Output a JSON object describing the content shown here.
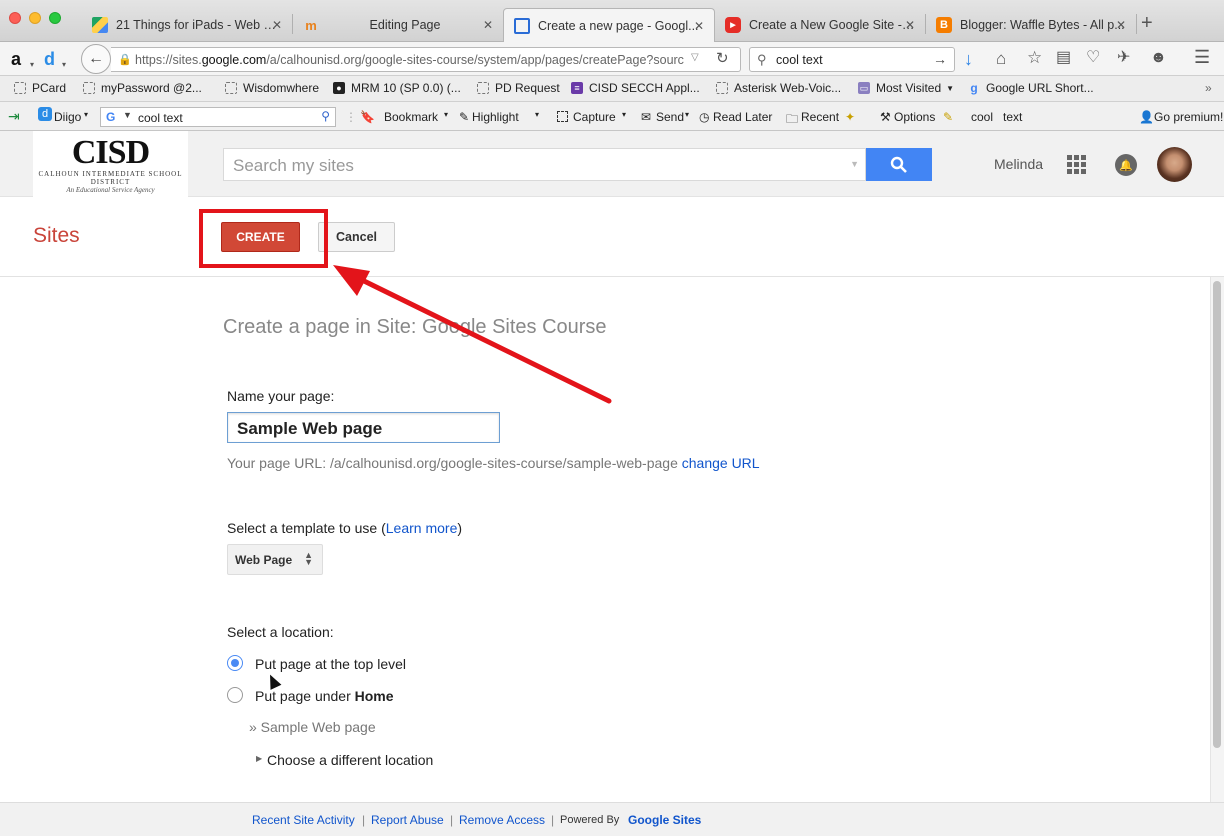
{
  "tabs": [
    {
      "label": "21 Things for iPads - Web R...",
      "icon": "google-drive-icon",
      "active": false
    },
    {
      "label": "Editing Page",
      "icon": "moodle-icon",
      "active": false
    },
    {
      "label": "Create a new page - Googl...",
      "icon": "google-sites-icon",
      "active": true
    },
    {
      "label": "Create a New Google Site - ...",
      "icon": "youtube-icon",
      "active": false
    },
    {
      "label": "Blogger: Waffle Bytes - All p...",
      "icon": "blogger-icon",
      "active": false
    }
  ],
  "nav": {
    "url_prefix": "https://sites.",
    "url_domain": "google.com",
    "url_rest": "/a/calhounisd.org/google-sites-course/system/app/pages/createPage?sourc",
    "search_value": "cool text"
  },
  "bookmarks": [
    {
      "label": "PCard"
    },
    {
      "label": "myPassword @2..."
    },
    {
      "label": "Wisdomwhere"
    },
    {
      "label": "MRM 10 (SP 0.0) (..."
    },
    {
      "label": "PD Request"
    },
    {
      "label": "CISD SECCH Appl..."
    },
    {
      "label": "Asterisk Web-Voic..."
    },
    {
      "label": "Most Visited"
    },
    {
      "label": "Google URL Short..."
    }
  ],
  "diigo": {
    "brand": "Diigo",
    "search_value": "cool text",
    "bookmark": "Bookmark",
    "highlight": "Highlight",
    "capture": "Capture",
    "send": "Send",
    "read_later": "Read Later",
    "recent": "Recent",
    "options": "Options",
    "word1": "cool",
    "word2": "text",
    "premium": "Go premium!"
  },
  "gheader": {
    "logo_main": "CISD",
    "logo_sub": "CALHOUN INTERMEDIATE SCHOOL DISTRICT",
    "logo_tag": "An Educational Service Agency",
    "search_placeholder": "Search my sites",
    "user_name": "Melinda"
  },
  "actions": {
    "sites_title": "Sites",
    "create_label": "CREATE",
    "cancel_label": "Cancel"
  },
  "form": {
    "heading": "Create a page in Site: Google Sites Course",
    "name_label": "Name your page:",
    "name_value": "Sample Web page",
    "url_prefix": "Your page URL: /a/calhounisd.org/google-sites-course/sample-web-page",
    "change_url": "change URL",
    "template_label": "Select a template to use (",
    "learn_more": "Learn more",
    "template_label_end": ")",
    "template_value": "Web Page",
    "location_label": "Select a location:",
    "loc_top": "Put page at the top level",
    "loc_under_prefix": "Put page under",
    "loc_under_bold": "Home",
    "breadcrumb": "» Sample Web page",
    "choose_location": "Choose a different location"
  },
  "footer": {
    "recent_activity": "Recent Site Activity",
    "report_abuse": "Report Abuse",
    "remove_access": "Remove Access",
    "powered_by": "Powered By",
    "google_sites": "Google Sites"
  },
  "colors": {
    "create_button": "#d14836",
    "sites_title": "#c9443a",
    "annotation_red": "#e3141a",
    "search_button": "#4285f4",
    "link": "#1155cc"
  }
}
